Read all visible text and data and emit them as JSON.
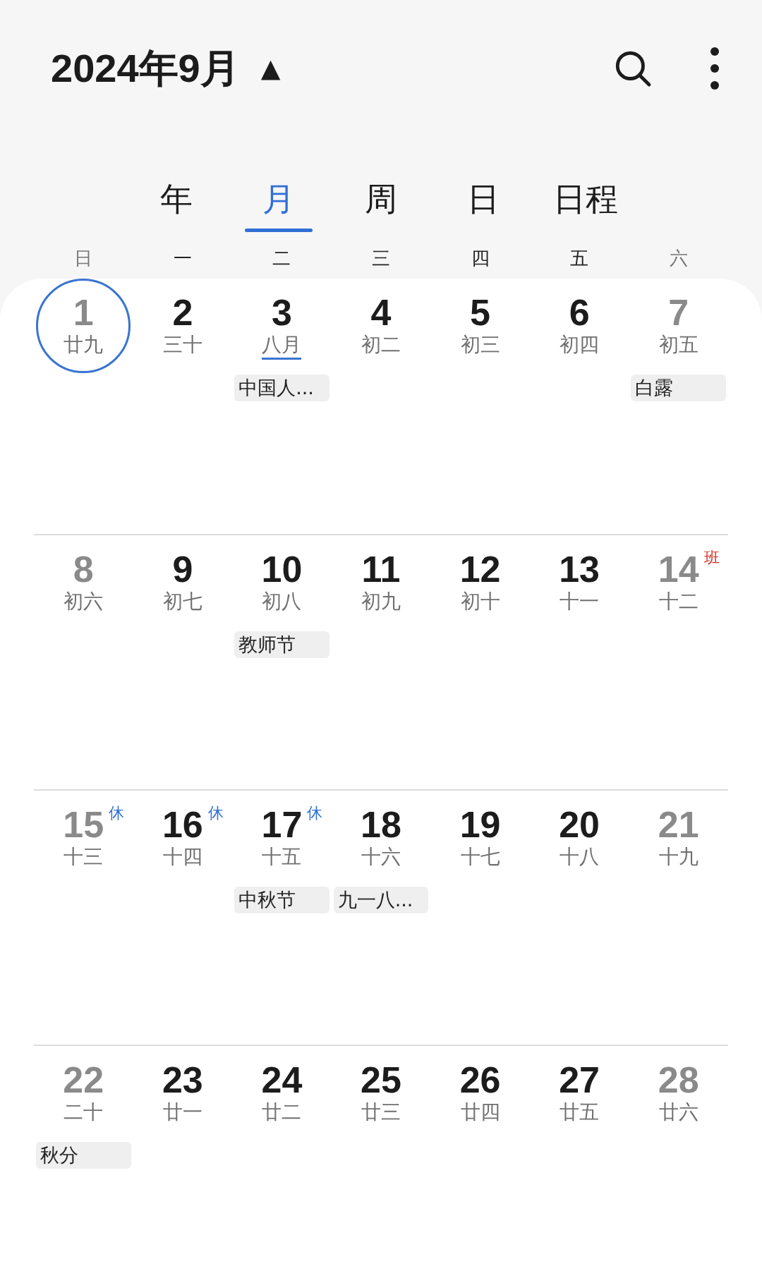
{
  "header": {
    "title": "2024年9月",
    "caret": "▲"
  },
  "tabs": [
    {
      "label": "年",
      "selected": false
    },
    {
      "label": "月",
      "selected": true
    },
    {
      "label": "周",
      "selected": false
    },
    {
      "label": "日",
      "selected": false
    },
    {
      "label": "日程",
      "selected": false
    }
  ],
  "weekdays": [
    {
      "label": "日",
      "weekend": true
    },
    {
      "label": "一",
      "weekend": false
    },
    {
      "label": "二",
      "weekend": false
    },
    {
      "label": "三",
      "weekend": false
    },
    {
      "label": "四",
      "weekend": false
    },
    {
      "label": "五",
      "weekend": false
    },
    {
      "label": "六",
      "weekend": true
    }
  ],
  "weeks": [
    [
      {
        "day": "1",
        "lunar": "廿九",
        "weekend": true,
        "selected": true
      },
      {
        "day": "2",
        "lunar": "三十",
        "weekend": false,
        "selected": false
      },
      {
        "day": "3",
        "lunar": "八月",
        "weekend": false,
        "selected": false,
        "month_start": true,
        "events": [
          "中国人..."
        ]
      },
      {
        "day": "4",
        "lunar": "初二",
        "weekend": false,
        "selected": false
      },
      {
        "day": "5",
        "lunar": "初三",
        "weekend": false,
        "selected": false
      },
      {
        "day": "6",
        "lunar": "初四",
        "weekend": false,
        "selected": false
      },
      {
        "day": "7",
        "lunar": "初五",
        "weekend": true,
        "selected": false,
        "events": [
          "白露"
        ]
      }
    ],
    [
      {
        "day": "8",
        "lunar": "初六",
        "weekend": true,
        "selected": false
      },
      {
        "day": "9",
        "lunar": "初七",
        "weekend": false,
        "selected": false
      },
      {
        "day": "10",
        "lunar": "初八",
        "weekend": false,
        "selected": false,
        "events": [
          "教师节"
        ]
      },
      {
        "day": "11",
        "lunar": "初九",
        "weekend": false,
        "selected": false
      },
      {
        "day": "12",
        "lunar": "初十",
        "weekend": false,
        "selected": false
      },
      {
        "day": "13",
        "lunar": "十一",
        "weekend": false,
        "selected": false
      },
      {
        "day": "14",
        "lunar": "十二",
        "weekend": true,
        "selected": false,
        "badge": {
          "text": "班",
          "kind": "work"
        }
      }
    ],
    [
      {
        "day": "15",
        "lunar": "十三",
        "weekend": true,
        "selected": false,
        "badge": {
          "text": "休",
          "kind": "rest"
        }
      },
      {
        "day": "16",
        "lunar": "十四",
        "weekend": false,
        "selected": false,
        "badge": {
          "text": "休",
          "kind": "rest"
        }
      },
      {
        "day": "17",
        "lunar": "十五",
        "weekend": false,
        "selected": false,
        "badge": {
          "text": "休",
          "kind": "rest"
        },
        "events": [
          "中秋节"
        ]
      },
      {
        "day": "18",
        "lunar": "十六",
        "weekend": false,
        "selected": false,
        "events": [
          "九一八..."
        ]
      },
      {
        "day": "19",
        "lunar": "十七",
        "weekend": false,
        "selected": false
      },
      {
        "day": "20",
        "lunar": "十八",
        "weekend": false,
        "selected": false
      },
      {
        "day": "21",
        "lunar": "十九",
        "weekend": true,
        "selected": false
      }
    ],
    [
      {
        "day": "22",
        "lunar": "二十",
        "weekend": true,
        "selected": false,
        "events": [
          "秋分"
        ]
      },
      {
        "day": "23",
        "lunar": "廿一",
        "weekend": false,
        "selected": false
      },
      {
        "day": "24",
        "lunar": "廿二",
        "weekend": false,
        "selected": false
      },
      {
        "day": "25",
        "lunar": "廿三",
        "weekend": false,
        "selected": false
      },
      {
        "day": "26",
        "lunar": "廿四",
        "weekend": false,
        "selected": false
      },
      {
        "day": "27",
        "lunar": "廿五",
        "weekend": false,
        "selected": false
      },
      {
        "day": "28",
        "lunar": "廿六",
        "weekend": true,
        "selected": false
      }
    ]
  ]
}
